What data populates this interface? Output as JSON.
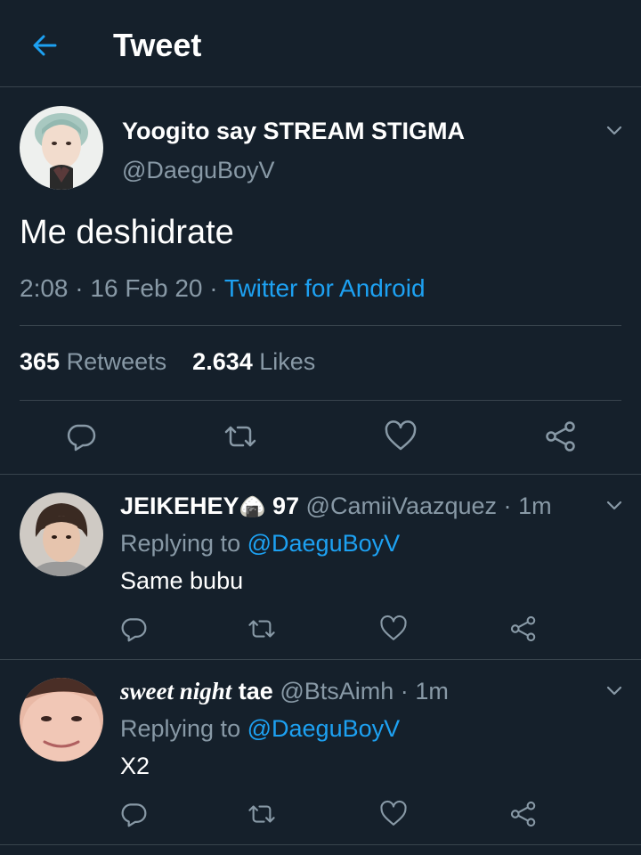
{
  "header": {
    "title": "Tweet",
    "back_icon": "arrow-left-icon"
  },
  "colors": {
    "background": "#15202b",
    "accent": "#1da1f2",
    "muted": "#8899a6",
    "divider": "#38444d"
  },
  "tweet": {
    "display_name": "Yoogito say STREAM STIGMA",
    "handle": "@DaeguBoyV",
    "text": "Me deshidrate",
    "time": "2:08",
    "date": "16 Feb 20",
    "sep": "·",
    "source": "Twitter for Android",
    "retweets_count": "365",
    "retweets_label": "Retweets",
    "likes_count": "2.634",
    "likes_label": "Likes"
  },
  "replies": [
    {
      "display_name": "JEIKEHEY",
      "name_emoji": "🍙",
      "name_suffix": "97",
      "handle": "@CamiiVaazquez",
      "sep": "·",
      "time": "1m",
      "replying_prefix": "Replying to",
      "replying_to": "@DaeguBoyV",
      "text": "Same bubu"
    },
    {
      "display_name_styled": "sweet night",
      "display_name_plain": "tae",
      "handle": "@BtsAimh",
      "sep": "·",
      "time": "1m",
      "replying_prefix": "Replying to",
      "replying_to": "@DaeguBoyV",
      "text": "X2"
    }
  ]
}
